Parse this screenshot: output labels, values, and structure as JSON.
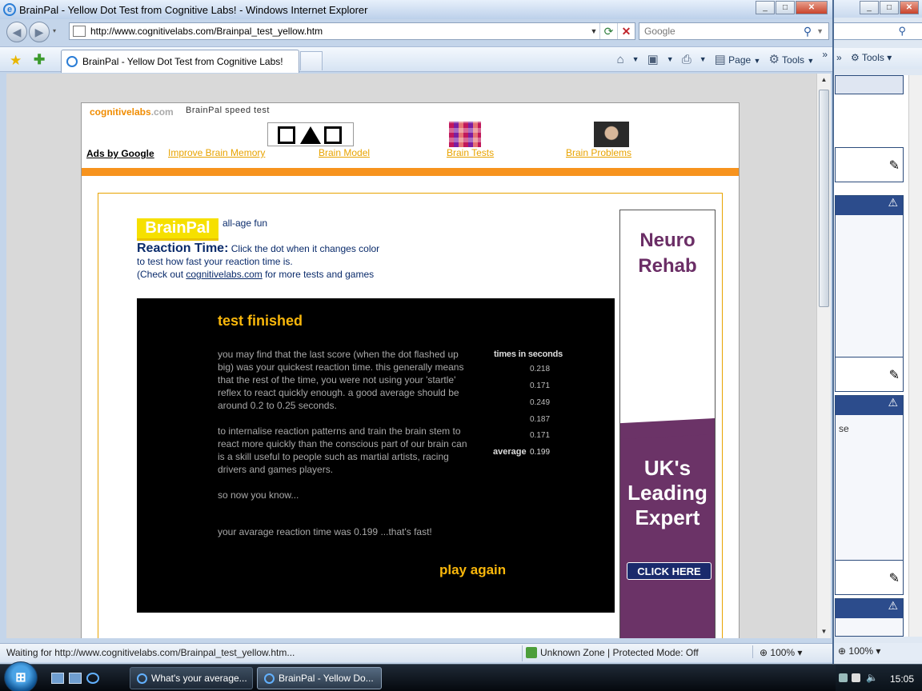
{
  "window": {
    "title": "BrainPal - Yellow Dot Test from Cognitive Labs! - Windows Internet Explorer",
    "minimize": "_",
    "maximize": "□",
    "close": "✕"
  },
  "nav": {
    "back_glyph": "◀",
    "forward_glyph": "▶",
    "address": "http://www.cognitivelabs.com/Brainpal_test_yellow.htm",
    "refresh_glyph": "⟳",
    "stop_glyph": "✕",
    "search_placeholder": "Google",
    "search_glyph": "⚲"
  },
  "toolbar": {
    "tab_title": "BrainPal - Yellow Dot Test from Cognitive Labs!",
    "page_label": "Page",
    "tools_label": "Tools",
    "overflow": "»"
  },
  "site": {
    "logo_main": "cognitivelabs",
    "logo_com": ".com",
    "subtitle": "BrainPal speed test",
    "ads_label": "Ads by Google",
    "ad_links": [
      "Improve Brain Memory",
      "Brain Model",
      "Brain Tests",
      "Brain Problems"
    ]
  },
  "intro": {
    "badge": "BrainPal",
    "tagline": "all-age fun",
    "rt_title": "Reaction Time:",
    "rt_text1": " Click the dot when it changes color",
    "rt_text2": "to test how fast your reaction time is.",
    "rt_text3_pre": "(Check out ",
    "rt_link": "cognitivelabs.com",
    "rt_text3_post": " for more tests and games"
  },
  "game": {
    "title": "test  finished",
    "para1": "you may find that the last score (when the dot flashed up big) was your quickest reaction time. this generally means that the rest of the time, you were not using your 'startle' reflex to react quickly enough. a good average should be around 0.2 to 0.25 seconds.",
    "para2": "to internalise reaction patterns and train the brain stem to react more quickly than the conscious part of our brain can is a skill useful to people such as martial artists, racing drivers and games players.",
    "para3": "so now you know...",
    "result": "your avarage reaction time was 0.199 ...that's fast!",
    "times_heading": "times in seconds",
    "times": [
      "0.218",
      "0.171",
      "0.249",
      "0.187",
      "0.171"
    ],
    "average_label": "average",
    "average_value": "0.199",
    "play_again": "play again"
  },
  "side_ad": {
    "line1": "Neuro",
    "line2": "Rehab",
    "uk1": "UK's",
    "uk2": "Leading",
    "uk3": "Expert",
    "cta": "CLICK HERE"
  },
  "status": {
    "text": "Waiting for http://www.cognitivelabs.com/Brainpal_test_yellow.htm...",
    "zone": "Unknown Zone | Protected Mode: Off",
    "zoom": "100%"
  },
  "bg_window": {
    "tools_label": "Tools",
    "fragment": "se",
    "zoom": "100%"
  },
  "taskbar": {
    "task1": "What's your average...",
    "task2": "BrainPal - Yellow Do...",
    "clock": "15:05"
  }
}
